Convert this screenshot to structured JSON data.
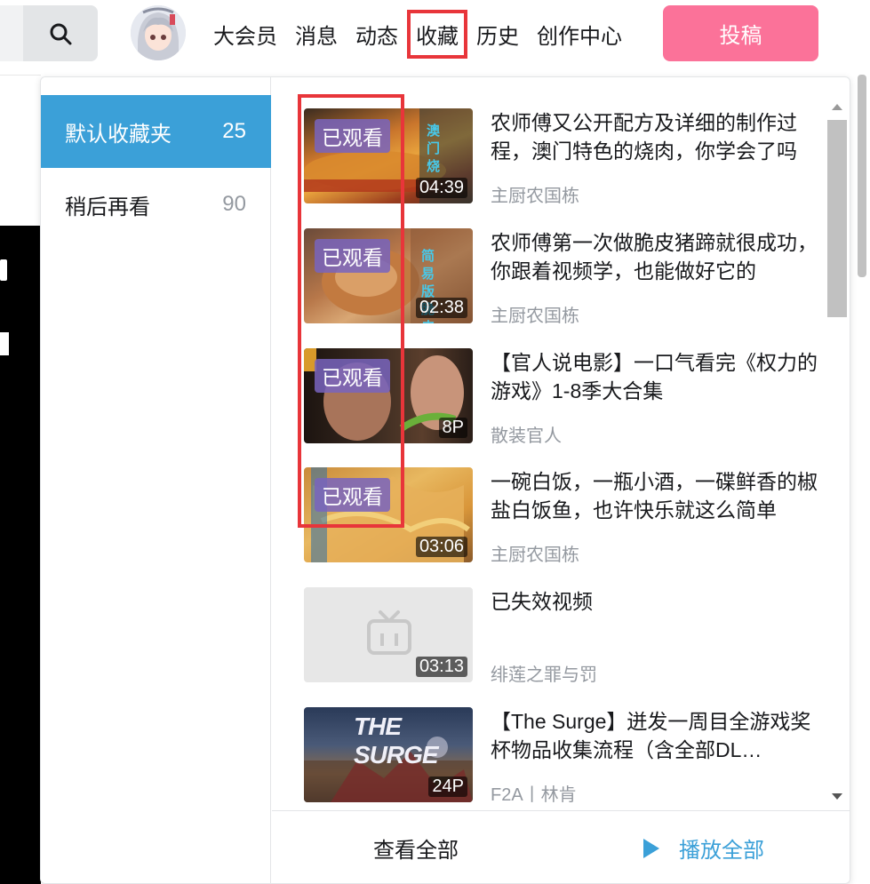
{
  "header": {
    "nav": [
      "大会员",
      "消息",
      "动态",
      "收藏",
      "历史",
      "创作中心"
    ],
    "active_nav": "收藏",
    "upload_label": "投稿"
  },
  "sidebar": {
    "folders": [
      {
        "name": "默认收藏夹",
        "count": "25"
      },
      {
        "name": "稍后再看",
        "count": "90"
      }
    ]
  },
  "videos": [
    {
      "title": "农师傅又公开配方及详细的制作过程，澳门特色的烧肉，你学会了吗",
      "up": "主厨农国栋",
      "duration": "04:39",
      "watched_label": "已观看",
      "thumb_text": "澳门烧"
    },
    {
      "title": "农师傅第一次做脆皮猪蹄就很成功，你跟着视频学，也能做好它的",
      "up": "主厨农国栋",
      "duration": "02:38",
      "watched_label": "已观看",
      "thumb_text": "简易版 脆皮猪"
    },
    {
      "title": "【官人说电影】一口气看完《权力的游戏》1-8季大合集",
      "up": "散装官人",
      "duration": "8P",
      "watched_label": "已观看"
    },
    {
      "title": "一碗白饭，一瓶小酒，一碟鲜香的椒盐白饭鱼，也许快乐就这么简单",
      "up": "主厨农国栋",
      "duration": "03:06",
      "watched_label": "已观看"
    },
    {
      "title": "已失效视频",
      "up": "绯莲之罪与罚",
      "duration": "03:13"
    },
    {
      "title": "【The Surge】迸发一周目全游戏奖杯物品收集流程（含全部DL…",
      "up": "F2A丨林肯",
      "duration": "24P",
      "thumb_text": "THE SURGE"
    }
  ],
  "footer": {
    "view_all": "查看全部",
    "play_all": "播放全部"
  },
  "colors": {
    "accent_blue": "#3ba0d8",
    "upload_pink": "#fb7299",
    "highlight_red": "#e8353a"
  }
}
